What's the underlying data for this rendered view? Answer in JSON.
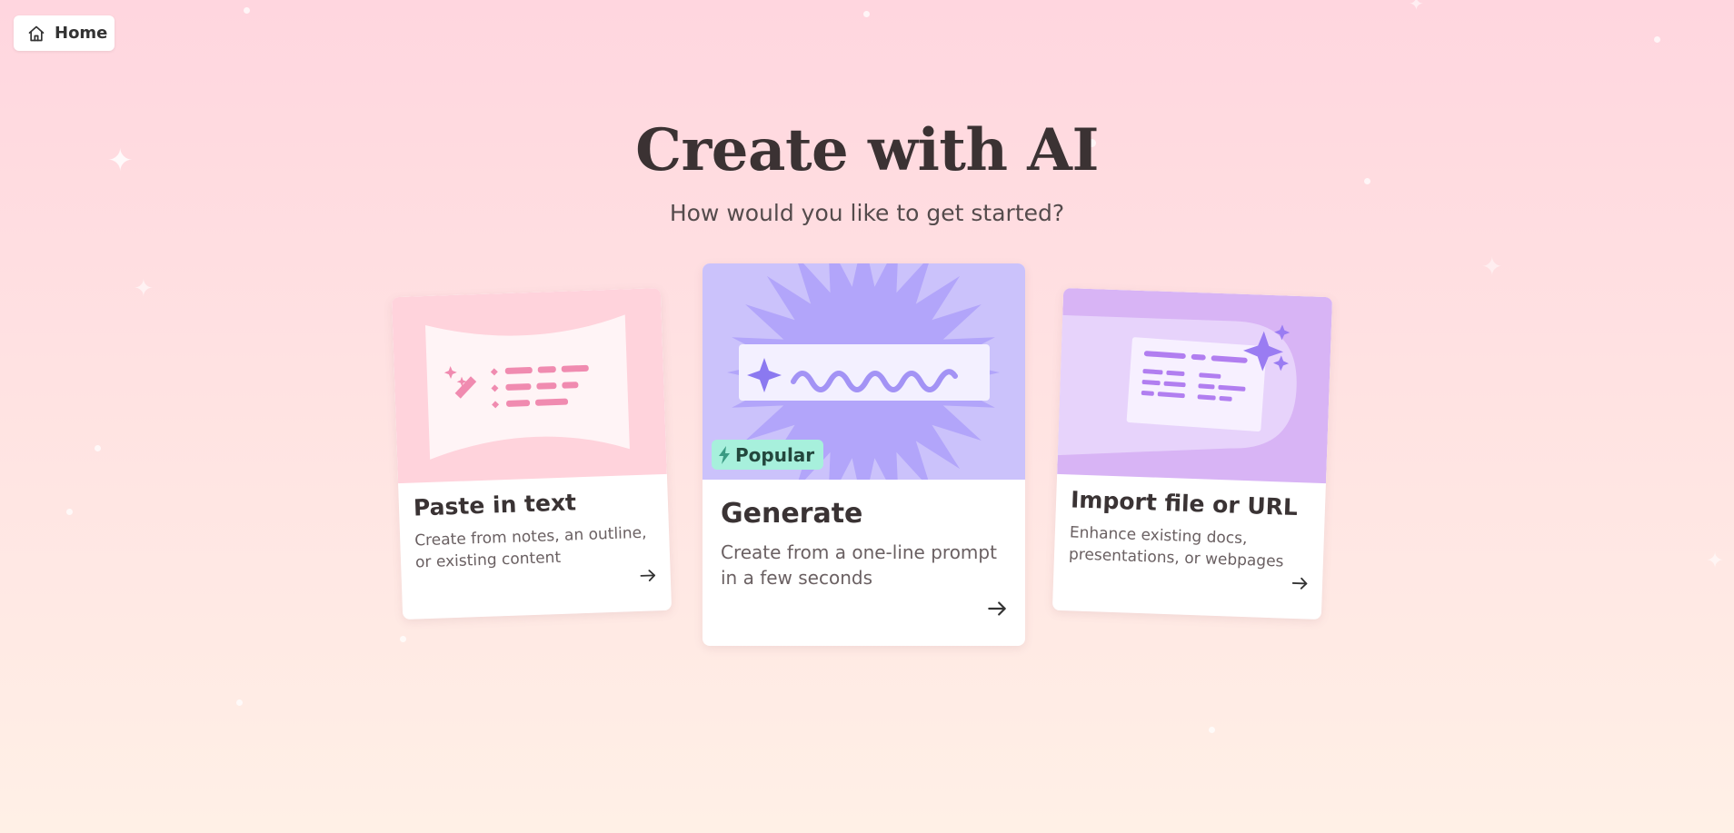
{
  "nav": {
    "home_label": "Home",
    "home_icon": "home-icon"
  },
  "header": {
    "title": "Create with AI",
    "subtitle": "How would you like to get started?"
  },
  "cards": [
    {
      "id": "paste",
      "title": "Paste in text",
      "description": "Create from notes, an outline, or existing content",
      "accent": "#ffd3dc",
      "icon": "arrow-right-icon"
    },
    {
      "id": "generate",
      "title": "Generate",
      "description": "Create from a one-line prompt in a few seconds",
      "badge": "Popular",
      "accent": "#cbc2fb",
      "icon": "arrow-right-icon"
    },
    {
      "id": "import",
      "title": "Import file or URL",
      "description": "Enhance existing docs, presentations, or webpages",
      "accent": "#d8b4f5",
      "icon": "arrow-right-icon"
    }
  ],
  "colors": {
    "background_top": "#ffd6df",
    "background_bottom": "#fff0e6",
    "badge_bg": "#a7f0dc",
    "title_text": "#3b3233"
  }
}
